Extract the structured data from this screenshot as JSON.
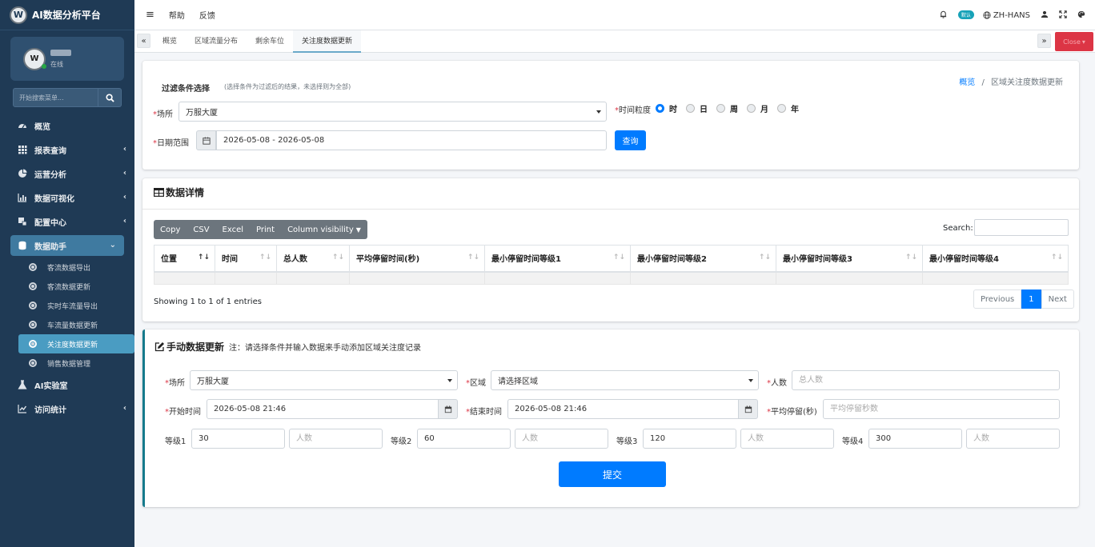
{
  "brand": {
    "title": "AI数据分析平台",
    "logo": "W"
  },
  "user": {
    "status": "在线",
    "avatar": "W"
  },
  "sidebar": {
    "search_placeholder": "开始搜索菜单...",
    "items": [
      {
        "label": "概览",
        "icon": "dashboard-icon"
      },
      {
        "label": "报表查询",
        "icon": "grid-icon"
      },
      {
        "label": "运营分析",
        "icon": "pie-icon"
      },
      {
        "label": "数据可视化",
        "icon": "bar-chart-icon"
      },
      {
        "label": "配置中心",
        "icon": "gear-icon"
      },
      {
        "label": "数据助手",
        "icon": "database-icon"
      },
      {
        "label": "AI实验室",
        "icon": "flask-icon"
      },
      {
        "label": "访问统计",
        "icon": "line-chart-icon"
      }
    ],
    "sub_items": [
      "客流数据导出",
      "客流数据更新",
      "实时车流量导出",
      "车流量数据更新",
      "关注度数据更新",
      "销售数据管理"
    ]
  },
  "topbar": {
    "help": "帮助",
    "feedback": "反馈",
    "badge": "默认",
    "lang": "ZH-HANS"
  },
  "tabs": [
    "概览",
    "区域流量分布",
    "剩余车位",
    "关注度数据更新"
  ],
  "tab_close": "Close",
  "filter": {
    "title": "过滤条件选择",
    "hint": "(选择条件为过滤后的结果，未选择则为全部)",
    "venue_label": "场所",
    "venue_value": "万服大厦",
    "granularity_label": "时间粒度",
    "granularity_options": [
      "时",
      "日",
      "周",
      "月",
      "年"
    ],
    "granularity_selected": "时",
    "date_label": "日期范围",
    "date_value": "2026-05-08 - 2026-05-08",
    "query_button": "查询"
  },
  "breadcrumb": {
    "home": "概览",
    "sep": "/",
    "current": "区域关注度数据更新"
  },
  "detail": {
    "title": "数据详情",
    "buttons": [
      "Copy",
      "CSV",
      "Excel",
      "Print",
      "Column visibility"
    ],
    "search_label": "Search:",
    "columns": [
      "位置",
      "时间",
      "总人数",
      "平均停留时间(秒)",
      "最小停留时间等级1",
      "最小停留时间等级2",
      "最小停留时间等级3",
      "最小停留时间等级4"
    ],
    "info": "Showing 1 to 1 of 1 entries",
    "pager": {
      "prev": "Previous",
      "page": "1",
      "next": "Next"
    }
  },
  "manual": {
    "title": "手动数据更新",
    "note": "注：请选择条件并输入数据来手动添加区域关注度记录",
    "venue_label": "场所",
    "venue_value": "万服大厦",
    "area_label": "区域",
    "area_value": "请选择区域",
    "people_label": "人数",
    "people_placeholder": "总人数",
    "start_label": "开始时间",
    "start_value": "2026-05-08 21:46",
    "end_label": "结束时间",
    "end_value": "2026-05-08 21:46",
    "avg_label": "平均停留(秒)",
    "avg_placeholder": "平均停留秒数",
    "levels": [
      {
        "label": "等级1",
        "value": "30",
        "placeholder": "人数"
      },
      {
        "label": "等级2",
        "value": "60",
        "placeholder": "人数"
      },
      {
        "label": "等级3",
        "value": "120",
        "placeholder": "人数"
      },
      {
        "label": "等级4",
        "value": "300",
        "placeholder": "人数"
      }
    ],
    "submit": "提交"
  },
  "colors": {
    "sidebar_bg": "#1f3a55",
    "primary": "#007bff",
    "danger": "#dc3545",
    "accent": "#157a8c"
  }
}
